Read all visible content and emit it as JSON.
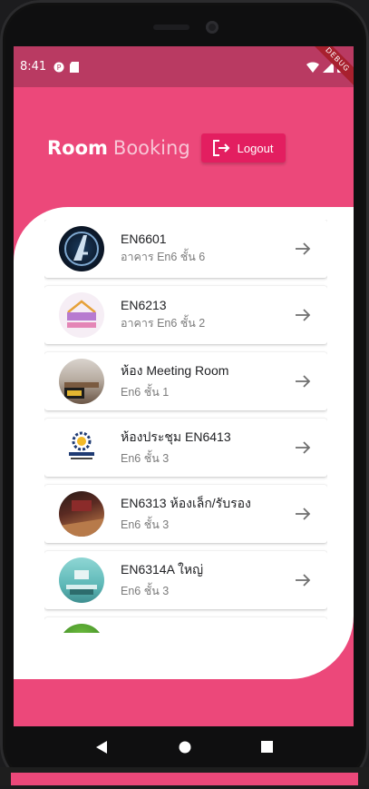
{
  "status_bar": {
    "time": "8:41",
    "debug_label": "DEBUG",
    "icons": [
      "p-icon",
      "sd-card-icon",
      "wifi-icon",
      "signal-icon",
      "battery-icon"
    ]
  },
  "header": {
    "title_bold": "Room",
    "title_light": "Booking",
    "logout_label": "Logout"
  },
  "colors": {
    "primary": "#ec487a",
    "statusbar": "#b93a62",
    "logout_button": "#e31e60"
  },
  "rooms": [
    {
      "name": "EN6601",
      "location": "อาคาร En6 ชั้น 6",
      "avatar": "avengers-logo"
    },
    {
      "name": "EN6213",
      "location": "อาคาร En6 ชั้น 2",
      "avatar": "home-logo"
    },
    {
      "name": "ห้อง Meeting Room",
      "location": "En6 ชั้น 1",
      "avatar": "meeting-room-photo"
    },
    {
      "name": "ห้องประชุม EN6413",
      "location": "En6 ชั้น 3",
      "avatar": "entech-logo"
    },
    {
      "name": "EN6313 ห้องเล็ก/รับรอง",
      "location": "En6 ชั้น 3",
      "avatar": "small-room-photo"
    },
    {
      "name": "EN6314A ใหญ่",
      "location": "En6 ชั้น 3",
      "avatar": "big-room-photo"
    },
    {
      "name": "",
      "location": "",
      "avatar": "partial-room-photo"
    }
  ]
}
